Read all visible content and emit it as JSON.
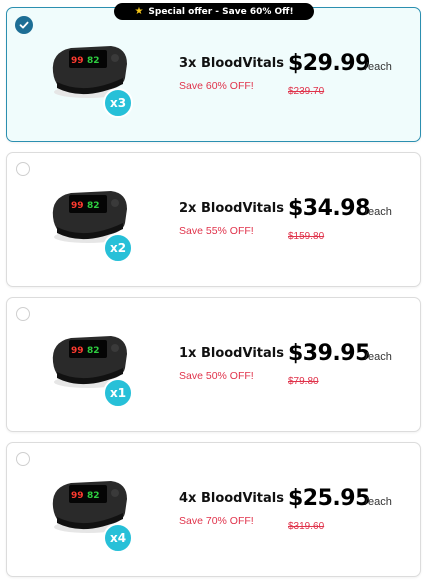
{
  "ribbon": {
    "text": "Special offer - Save 60% Off!",
    "icon": "star-icon"
  },
  "offers": [
    {
      "name": "3x BloodVitals",
      "save": "Save 60% OFF!",
      "price": "$29.99",
      "each": "/each",
      "old_price": "$239.70",
      "qty_badge": "x3",
      "selected": true
    },
    {
      "name": "2x BloodVitals",
      "save": "Save 55% OFF!",
      "price": "$34.98",
      "each": "/each",
      "old_price": "$159.80",
      "qty_badge": "x2",
      "selected": false
    },
    {
      "name": "1x BloodVitals",
      "save": "Save 50% OFF!",
      "price": "$39.95",
      "each": "/each",
      "old_price": "$79.80",
      "qty_badge": "x1",
      "selected": false
    },
    {
      "name": "4x BloodVitals",
      "save": "Save 70% OFF!",
      "price": "$25.95",
      "each": "/each",
      "old_price": "$319.60",
      "qty_badge": "x4",
      "selected": false
    }
  ],
  "device_display": {
    "spo2": "99",
    "pulse": "82"
  },
  "colors": {
    "accent_badge": "#27c0d8",
    "discount_red": "#e0334b",
    "selected_border": "#2b8fb0",
    "selected_bg": "#f0fcfc",
    "radio_checked": "#1d6e95"
  }
}
